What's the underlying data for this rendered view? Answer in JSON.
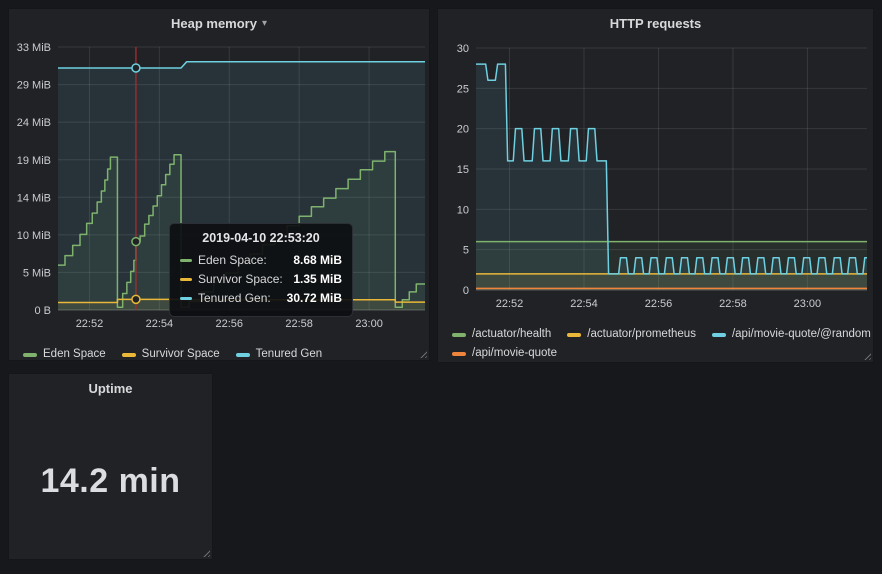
{
  "colors": {
    "page_bg": "#17181b",
    "panel_bg": "#202226",
    "green": "#7eb26d",
    "yellow": "#eab839",
    "cyan": "#6ed0e0",
    "orange": "#ef843c",
    "crosshair_red": "#a02c2c"
  },
  "panels": {
    "heap": {
      "title": "Heap memory",
      "menu_caret": "▾"
    },
    "http": {
      "title": "HTTP requests"
    },
    "uptime": {
      "title": "Uptime",
      "value": "14.2 min"
    }
  },
  "chart_data": [
    {
      "type": "line",
      "title": "Heap memory",
      "x_domain": [
        51.1,
        61.6
      ],
      "y_domain": [
        0,
        33.38
      ],
      "x_ticks": [
        {
          "t": 52,
          "label": "22:52"
        },
        {
          "t": 54,
          "label": "22:54"
        },
        {
          "t": 56,
          "label": "22:56"
        },
        {
          "t": 58,
          "label": "22:58"
        },
        {
          "t": 60,
          "label": "23:00"
        }
      ],
      "y_ticks": [
        {
          "v": 0,
          "label": "0 B"
        },
        {
          "v": 4.77,
          "label": "5 MiB"
        },
        {
          "v": 9.54,
          "label": "10 MiB"
        },
        {
          "v": 14.31,
          "label": "14 MiB"
        },
        {
          "v": 19.07,
          "label": "19 MiB"
        },
        {
          "v": 23.84,
          "label": "24 MiB"
        },
        {
          "v": 28.61,
          "label": "29 MiB"
        },
        {
          "v": 33.38,
          "label": "33 MiB"
        }
      ],
      "series": [
        {
          "label": "Eden Space",
          "color": "#7eb26d",
          "step": true,
          "fill": 0.09,
          "points": [
            [
              51.1,
              5.7
            ],
            [
              51.3,
              6.9
            ],
            [
              51.52,
              8.2
            ],
            [
              51.73,
              9.6
            ],
            [
              51.92,
              11.0
            ],
            [
              52.08,
              12.3
            ],
            [
              52.22,
              13.7
            ],
            [
              52.34,
              15.1
            ],
            [
              52.44,
              16.5
            ],
            [
              52.52,
              17.9
            ],
            [
              52.6,
              19.4
            ],
            [
              52.8,
              0.35
            ],
            [
              52.95,
              2.1
            ],
            [
              53.07,
              3.5
            ],
            [
              53.18,
              4.9
            ],
            [
              53.27,
              6.3
            ],
            [
              53.33,
              8.68
            ],
            [
              53.45,
              9.4
            ],
            [
              53.58,
              10.9
            ],
            [
              53.7,
              12.0
            ],
            [
              53.82,
              13.2
            ],
            [
              53.94,
              14.5
            ],
            [
              54.06,
              15.9
            ],
            [
              54.18,
              17.2
            ],
            [
              54.3,
              18.5
            ],
            [
              54.42,
              19.7
            ],
            [
              54.62,
              0.35
            ],
            [
              54.85,
              1.1
            ],
            [
              55.2,
              2.3
            ],
            [
              55.55,
              3.5
            ],
            [
              55.9,
              4.7
            ],
            [
              56.25,
              5.9
            ],
            [
              56.6,
              7.1
            ],
            [
              56.95,
              8.3
            ],
            [
              57.3,
              9.5
            ],
            [
              57.65,
              10.7
            ],
            [
              58.0,
              11.9
            ],
            [
              58.35,
              13.1
            ],
            [
              58.7,
              14.2
            ],
            [
              59.05,
              15.4
            ],
            [
              59.4,
              16.6
            ],
            [
              59.75,
              17.8
            ],
            [
              60.1,
              18.9
            ],
            [
              60.45,
              20.1
            ],
            [
              60.75,
              0.35
            ],
            [
              60.95,
              1.3
            ],
            [
              61.15,
              2.3
            ],
            [
              61.35,
              3.3
            ]
          ]
        },
        {
          "label": "Survivor Space",
          "color": "#eab839",
          "step": true,
          "fill": 0.09,
          "points": [
            [
              51.1,
              0.95
            ],
            [
              52.8,
              1.35
            ],
            [
              54.62,
              1.3
            ],
            [
              60.75,
              1.0
            ]
          ]
        },
        {
          "label": "Tenured Gen",
          "color": "#6ed0e0",
          "step": false,
          "fill": 0.1,
          "points": [
            [
              51.1,
              30.72
            ],
            [
              54.62,
              30.72
            ],
            [
              54.78,
              31.5
            ],
            [
              61.6,
              31.5
            ]
          ]
        }
      ],
      "crosshair": {
        "t": 53.33,
        "color": "#a02c2c"
      },
      "tooltip": {
        "timestamp": "2019-04-10 22:53:20",
        "rows": [
          {
            "label": "Eden Space:",
            "value": "8.68 MiB",
            "color": "#7eb26d"
          },
          {
            "label": "Survivor Space:",
            "value": "1.35 MiB",
            "color": "#eab839"
          },
          {
            "label": "Tenured Gen:",
            "value": "30.72 MiB",
            "color": "#6ed0e0"
          }
        ]
      }
    },
    {
      "type": "line",
      "title": "HTTP requests",
      "x_domain": [
        51.1,
        61.6
      ],
      "y_domain": [
        0,
        30
      ],
      "x_ticks": [
        {
          "t": 52,
          "label": "22:52"
        },
        {
          "t": 54,
          "label": "22:54"
        },
        {
          "t": 56,
          "label": "22:56"
        },
        {
          "t": 58,
          "label": "22:58"
        },
        {
          "t": 60,
          "label": "23:00"
        }
      ],
      "y_ticks": [
        {
          "v": 0,
          "label": "0"
        },
        {
          "v": 5,
          "label": "5"
        },
        {
          "v": 10,
          "label": "10"
        },
        {
          "v": 15,
          "label": "15"
        },
        {
          "v": 20,
          "label": "20"
        },
        {
          "v": 25,
          "label": "25"
        },
        {
          "v": 30,
          "label": "30"
        }
      ],
      "series": [
        {
          "label": "/actuator/health",
          "color": "#7eb26d",
          "step": false,
          "fill": 0.09,
          "points": [
            [
              51.1,
              6
            ],
            [
              61.6,
              6
            ]
          ]
        },
        {
          "label": "/actuator/prometheus",
          "color": "#eab839",
          "step": false,
          "fill": 0.09,
          "points": [
            [
              51.1,
              2
            ],
            [
              61.6,
              2
            ]
          ]
        },
        {
          "label": "/api/movie-quote/@random",
          "color": "#6ed0e0",
          "step": false,
          "fill": 0.1,
          "points": [
            [
              51.1,
              28
            ],
            [
              51.36,
              28
            ],
            [
              51.42,
              26
            ],
            [
              51.62,
              26
            ],
            [
              51.68,
              28
            ],
            [
              51.89,
              28
            ],
            [
              51.95,
              16
            ],
            [
              52.1,
              16
            ],
            [
              52.16,
              20
            ],
            [
              52.33,
              20
            ],
            [
              52.39,
              16
            ],
            [
              52.61,
              16
            ],
            [
              52.67,
              20
            ],
            [
              52.84,
              20
            ],
            [
              52.9,
              16
            ],
            [
              53.09,
              16
            ],
            [
              53.15,
              20
            ],
            [
              53.32,
              20
            ],
            [
              53.38,
              16
            ],
            [
              53.58,
              16
            ],
            [
              53.64,
              20
            ],
            [
              53.81,
              20
            ],
            [
              53.87,
              16
            ],
            [
              54.06,
              16
            ],
            [
              54.12,
              20
            ],
            [
              54.29,
              20
            ],
            [
              54.35,
              16
            ],
            [
              54.6,
              16
            ],
            [
              54.66,
              2
            ],
            [
              54.93,
              2
            ],
            [
              54.98,
              4
            ],
            [
              55.14,
              4
            ],
            [
              55.19,
              2
            ],
            [
              55.34,
              2
            ],
            [
              55.39,
              4
            ],
            [
              55.55,
              4
            ],
            [
              55.6,
              2
            ],
            [
              55.75,
              2
            ],
            [
              55.8,
              4
            ],
            [
              55.96,
              4
            ],
            [
              56.01,
              2
            ],
            [
              56.16,
              2
            ],
            [
              56.21,
              4
            ],
            [
              56.37,
              4
            ],
            [
              56.42,
              2
            ],
            [
              56.57,
              2
            ],
            [
              56.62,
              4
            ],
            [
              56.78,
              4
            ],
            [
              56.83,
              2
            ],
            [
              56.98,
              2
            ],
            [
              57.03,
              4
            ],
            [
              57.19,
              4
            ],
            [
              57.24,
              2
            ],
            [
              57.39,
              2
            ],
            [
              57.44,
              4
            ],
            [
              57.6,
              4
            ],
            [
              57.65,
              2
            ],
            [
              57.8,
              2
            ],
            [
              57.85,
              4
            ],
            [
              58.01,
              4
            ],
            [
              58.06,
              2
            ],
            [
              58.21,
              2
            ],
            [
              58.26,
              4
            ],
            [
              58.42,
              4
            ],
            [
              58.47,
              2
            ],
            [
              58.62,
              2
            ],
            [
              58.67,
              4
            ],
            [
              58.83,
              4
            ],
            [
              58.88,
              2
            ],
            [
              59.03,
              2
            ],
            [
              59.08,
              4
            ],
            [
              59.24,
              4
            ],
            [
              59.29,
              2
            ],
            [
              59.44,
              2
            ],
            [
              59.49,
              4
            ],
            [
              59.65,
              4
            ],
            [
              59.7,
              2
            ],
            [
              59.85,
              2
            ],
            [
              59.9,
              4
            ],
            [
              60.06,
              4
            ],
            [
              60.11,
              2
            ],
            [
              60.26,
              2
            ],
            [
              60.31,
              4
            ],
            [
              60.47,
              4
            ],
            [
              60.52,
              2
            ],
            [
              60.67,
              2
            ],
            [
              60.72,
              4
            ],
            [
              60.88,
              4
            ],
            [
              60.93,
              2
            ],
            [
              61.08,
              2
            ],
            [
              61.13,
              4
            ],
            [
              61.29,
              4
            ],
            [
              61.34,
              2
            ],
            [
              61.49,
              2
            ],
            [
              61.54,
              4
            ],
            [
              61.6,
              4
            ]
          ]
        },
        {
          "label": "/api/movie-quote",
          "color": "#ef843c",
          "step": false,
          "fill": 0.09,
          "points": [
            [
              51.1,
              0.2
            ],
            [
              61.6,
              0.2
            ]
          ]
        }
      ]
    }
  ]
}
